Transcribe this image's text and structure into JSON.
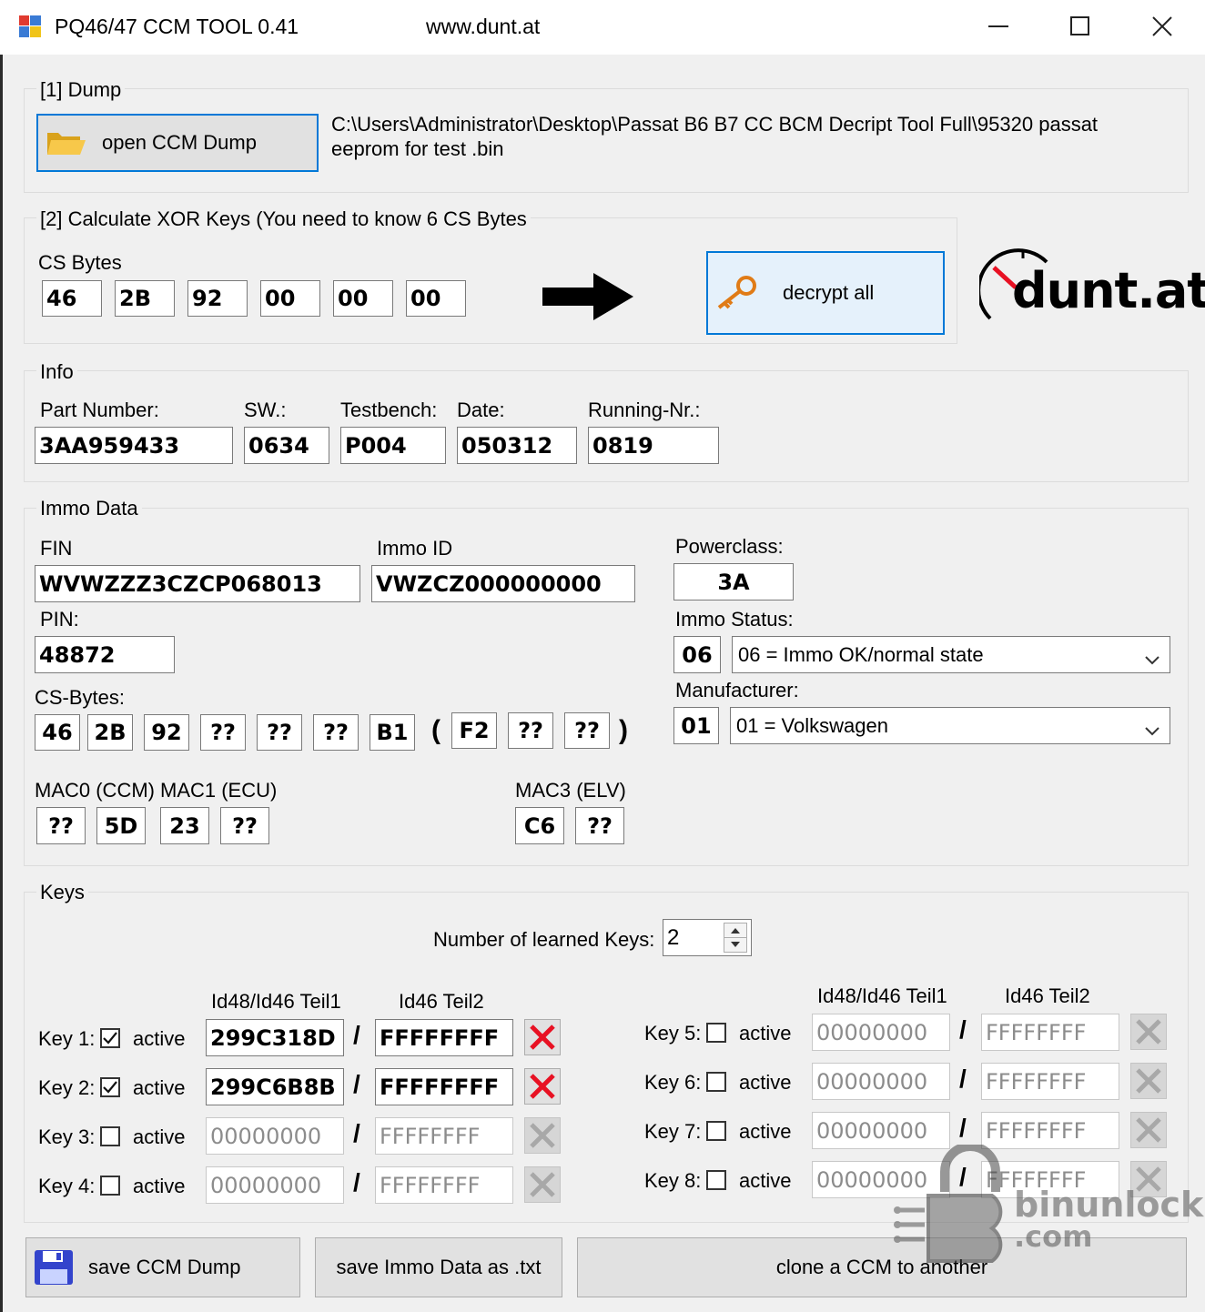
{
  "window": {
    "title": "PQ46/47 CCM TOOL 0.41",
    "url": "www.dunt.at",
    "minimize": "—",
    "maximize": "☐",
    "close": "✕"
  },
  "dump": {
    "group_label": "[1] Dump",
    "open_button": "open CCM Dump",
    "path": "C:\\Users\\Administrator\\Desktop\\Passat B6 B7 CC BCM Decript Tool Full\\95320 passat eeprom for test .bin"
  },
  "xor": {
    "group_label": "[2] Calculate XOR Keys (You need to know 6 CS Bytes",
    "cs_label": "CS Bytes",
    "cs_bytes": [
      "46",
      "2B",
      "92",
      "00",
      "00",
      "00"
    ],
    "decrypt_button": "decrypt all",
    "logo_text": "dunt.at"
  },
  "info": {
    "group_label": "Info",
    "part_number_label": "Part Number:",
    "part_number": "3AA959433",
    "sw_label": "SW.:",
    "sw": "0634",
    "testbench_label": "Testbench:",
    "testbench": "P004",
    "date_label": "Date:",
    "date": "050312",
    "running_label": "Running-Nr.:",
    "running": "0819"
  },
  "immo": {
    "group_label": "Immo Data",
    "fin_label": "FIN",
    "fin": "WVWZZZ3CZCP068013",
    "immo_id_label": "Immo ID",
    "immo_id": "VWZCZ000000000",
    "pin_label": "PIN:",
    "pin": "48872",
    "cs_label": "CS-Bytes:",
    "cs_bytes": [
      "46",
      "2B",
      "92",
      "??",
      "??",
      "??",
      "B1"
    ],
    "paren_open": "(",
    "paren_close": ")",
    "cs_extra": [
      "F2",
      "??",
      "??"
    ],
    "mac0_label": "MAC0 (CCM)",
    "mac1_label": "MAC1 (ECU)",
    "mac3_label": "MAC3 (ELV)",
    "mac01_bytes": [
      "??",
      "5D",
      "23",
      "??"
    ],
    "mac3_bytes": [
      "C6",
      "??"
    ],
    "powerclass_label": "Powerclass:",
    "powerclass": "3A",
    "status_label": "Immo Status:",
    "status_code": "06",
    "status_text": "06 = Immo OK/normal state",
    "manufacturer_label": "Manufacturer:",
    "manufacturer_code": "01",
    "manufacturer_text": "01 = Volkswagen"
  },
  "keys": {
    "group_label": "Keys",
    "learned_label": "Number of learned Keys:",
    "learned_value": "2",
    "col1_header": "Id48/Id46 Teil1",
    "col2_header": "Id46 Teil2",
    "active_label": "active",
    "separator": "/",
    "left": [
      {
        "label": "Key 1:",
        "active": true,
        "teil1": "299C318D",
        "teil2": "FFFFFFFF"
      },
      {
        "label": "Key 2:",
        "active": true,
        "teil1": "299C6B8B",
        "teil2": "FFFFFFFF"
      },
      {
        "label": "Key 3:",
        "active": false,
        "teil1": "00000000",
        "teil2": "FFFFFFFF"
      },
      {
        "label": "Key 4:",
        "active": false,
        "teil1": "00000000",
        "teil2": "FFFFFFFF"
      }
    ],
    "right": [
      {
        "label": "Key 5:",
        "active": false,
        "teil1": "00000000",
        "teil2": "FFFFFFFF"
      },
      {
        "label": "Key 6:",
        "active": false,
        "teil1": "00000000",
        "teil2": "FFFFFFFF"
      },
      {
        "label": "Key 7:",
        "active": false,
        "teil1": "00000000",
        "teil2": "FFFFFFFF"
      },
      {
        "label": "Key 8:",
        "active": false,
        "teil1": "00000000",
        "teil2": "FFFFFFFF"
      }
    ]
  },
  "bottom": {
    "save_dump": "save CCM Dump",
    "save_immo": "save Immo Data as .txt",
    "clone": "clone a CCM to another"
  },
  "watermark": {
    "line1": "binunlock",
    "line2": ".com"
  },
  "colors": {
    "accent_blue": "#0078d7",
    "red_x": "#e81123",
    "gray_x": "#a8a8a8"
  }
}
